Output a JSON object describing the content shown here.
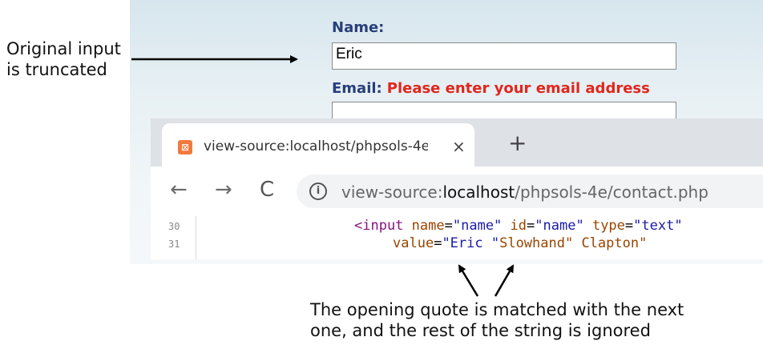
{
  "callouts": {
    "left_line1": "Original input",
    "left_line2": "is truncated",
    "bottom_line1": "The opening quote is matched with the next",
    "bottom_line2": "one, and the rest of the string is ignored"
  },
  "form": {
    "name_label": "Name:",
    "name_value": "Eric",
    "email_label": "Email:",
    "email_error": "Please enter your email address"
  },
  "browser": {
    "tab_title": "view-source:localhost/phpsols-4e",
    "tab_close": "×",
    "new_tab": "+",
    "nav_back": "←",
    "nav_forward": "→",
    "nav_reload": "C",
    "info_icon": "i",
    "url_prefix": "view-source:",
    "url_host": "localhost",
    "url_path": "/phpsols-4e/contact.php"
  },
  "source": {
    "line30_no": "30",
    "line31_no": "31",
    "line30": {
      "tag_open": "<input",
      "attr1": "name",
      "eq1": "=",
      "val1": "\"name\"",
      "attr2": "id",
      "eq2": "=",
      "val2": "\"name\"",
      "attr3": "type",
      "eq3": "=",
      "val3": "\"text\""
    },
    "line31": {
      "attr": "value",
      "eq": "=",
      "val": "\"Eric \"",
      "rest": "Slowhand\" Clapton\""
    }
  },
  "colors": {
    "label_blue": "#283e7a",
    "error_red": "#e1261c",
    "tag_purple": "#881280",
    "attr_brown": "#994500",
    "value_blue": "#1a1aa6"
  }
}
